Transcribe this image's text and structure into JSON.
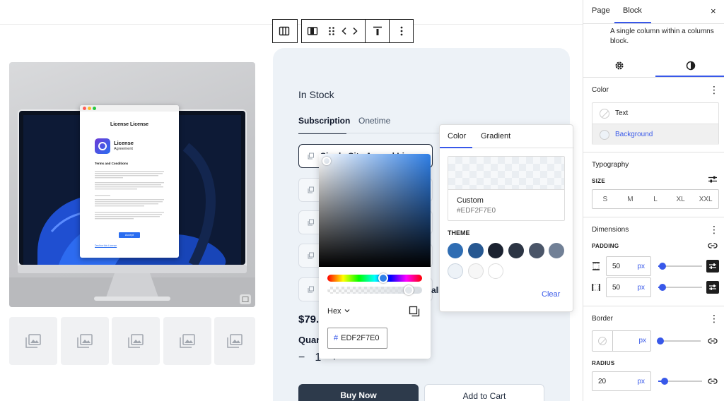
{
  "canvas": {
    "toolbar": {
      "icons": [
        "columns-icon",
        "column-icon",
        "drag-handle-icon",
        "chevron-left-icon",
        "chevron-right-icon",
        "align-top-icon",
        "more-vertical-icon"
      ]
    },
    "mockup": {
      "window_title": "License License",
      "product_name": "License",
      "product_sub": "Agreement",
      "section_heading": "Terms and Conditions",
      "accept_label": "Accept",
      "link_text": "Decline this License"
    },
    "product": {
      "stock_status": "In Stock",
      "tabs": [
        "Subscription",
        "Onetime"
      ],
      "variants": [
        {
          "label": "Single Site Annual License"
        },
        {
          "label": ""
        },
        {
          "label": ""
        },
        {
          "label": ""
        },
        {
          "label": ""
        }
      ],
      "variant_cut_text": "all",
      "price": "$79.0",
      "quantity_label": "Quan",
      "quantity": {
        "minus": "−",
        "value": "1",
        "plus": "+"
      },
      "buy_now": "Buy Now",
      "add_to_cart": "Add to Cart"
    },
    "picker": {
      "mode": "Hex",
      "hex_prefix": "#",
      "hex_value": "EDF2F7E0"
    },
    "color_popover": {
      "tabs": [
        "Color",
        "Gradient"
      ],
      "preview_name": "Custom",
      "preview_hex": "#EDF2F7E0",
      "theme_label": "THEME",
      "swatches": [
        "#2f6db3",
        "#275891",
        "#1b2230",
        "#2c3544",
        "#4a5568",
        "#718096",
        "#edf2f7",
        "#f7f7f7",
        "#ffffff"
      ],
      "clear_label": "Clear"
    }
  },
  "sidebar": {
    "tabs": [
      "Page",
      "Block"
    ],
    "close_icon": "×",
    "description": "A single column within a columns block.",
    "color": {
      "title": "Color",
      "items": [
        "Text",
        "Background"
      ]
    },
    "typography": {
      "title": "Typography",
      "size_label": "SIZE",
      "sizes": [
        "S",
        "M",
        "L",
        "XL",
        "XXL"
      ]
    },
    "dimensions": {
      "title": "Dimensions",
      "padding_label": "PADDING",
      "padding_vertical": "50",
      "padding_horizontal": "50",
      "unit": "px",
      "padding_vertical_level": 0.05,
      "padding_horizontal_level": 0.05
    },
    "border": {
      "title": "Border",
      "width_value": "",
      "unit": "px",
      "radius_label": "RADIUS",
      "radius_value": "20",
      "radius_unit": "px",
      "radius_level": 0.1
    },
    "accent": "#3858e9"
  }
}
